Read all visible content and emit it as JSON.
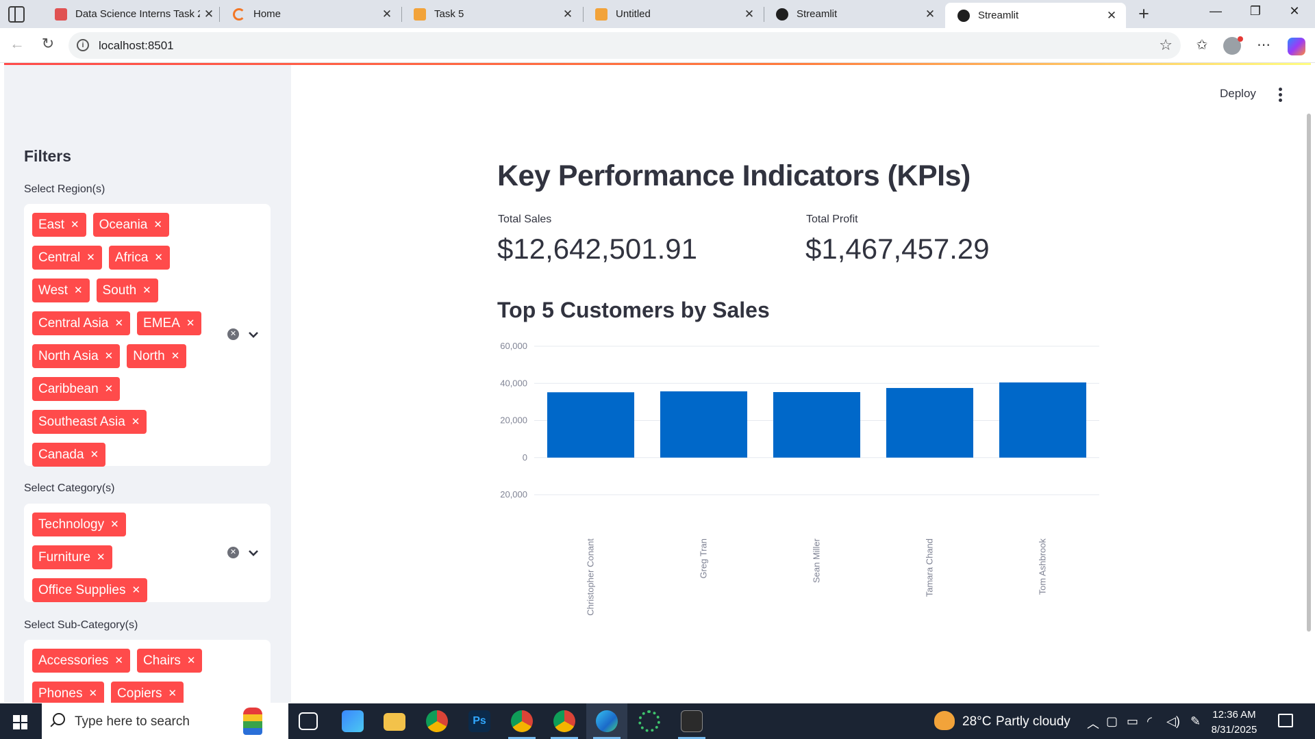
{
  "browser": {
    "tabs": [
      {
        "title": "Data Science Interns Task 2.pdf",
        "icon": "pdf-icon",
        "color": "#e05252",
        "active": false
      },
      {
        "title": "Home",
        "icon": "jupyter-icon",
        "color": "#f37726",
        "active": false
      },
      {
        "title": "Task 5",
        "icon": "notebook-icon",
        "color": "#f2a33a",
        "active": false
      },
      {
        "title": "Untitled",
        "icon": "notebook-icon",
        "color": "#f2a33a",
        "active": false
      },
      {
        "title": "Streamlit",
        "icon": "streamlit-icon",
        "color": "#1f1f1f",
        "active": false
      },
      {
        "title": "Streamlit",
        "icon": "streamlit-icon",
        "color": "#1f1f1f",
        "active": true
      }
    ],
    "url": "localhost:8501"
  },
  "header": {
    "deploy_label": "Deploy"
  },
  "sidebar": {
    "title": "Filters",
    "region": {
      "label": "Select Region(s)",
      "rows": [
        [
          "East",
          "Oceania"
        ],
        [
          "Central",
          "Africa"
        ],
        [
          "West",
          "South"
        ],
        [
          "Central Asia",
          "EMEA"
        ],
        [
          "North Asia",
          "North"
        ],
        [
          "Caribbean"
        ],
        [
          "Southeast Asia"
        ],
        [
          "Canada"
        ]
      ]
    },
    "category": {
      "label": "Select Category(s)",
      "rows": [
        [
          "Technology"
        ],
        [
          "Furniture"
        ],
        [
          "Office Supplies"
        ]
      ]
    },
    "subcategory": {
      "label": "Select Sub-Category(s)",
      "rows": [
        [
          "Accessories",
          "Chairs"
        ],
        [
          "Phones",
          "Copiers"
        ]
      ]
    }
  },
  "main": {
    "title": "Key Performance Indicators (KPIs)",
    "metrics": {
      "total_sales_label": "Total Sales",
      "total_sales_value": "$12,642,501.91",
      "total_profit_label": "Total Profit",
      "total_profit_value": "$1,467,457.29"
    },
    "chart_title": "Top 5 Customers by Sales"
  },
  "chart_data": {
    "type": "bar",
    "categories": [
      "Christopher Conant",
      "Greg Tran",
      "Sean Miller",
      "Tamara Chand",
      "Tom Ashbrook"
    ],
    "values": [
      35200,
      35700,
      35300,
      37500,
      40500
    ],
    "y_ticks": [
      60000,
      40000,
      20000,
      0,
      -20000
    ],
    "y_tick_labels": [
      "60,000",
      "40,000",
      "20,000",
      "0",
      "20,000"
    ],
    "ylim": [
      -20000,
      60000
    ],
    "color": "#0068c9",
    "grid": true
  },
  "taskbar": {
    "search_placeholder": "Type here to search",
    "weather_temp": "28°C",
    "weather_desc": "Partly cloudy",
    "time": "12:36 AM",
    "date": "8/31/2025"
  }
}
